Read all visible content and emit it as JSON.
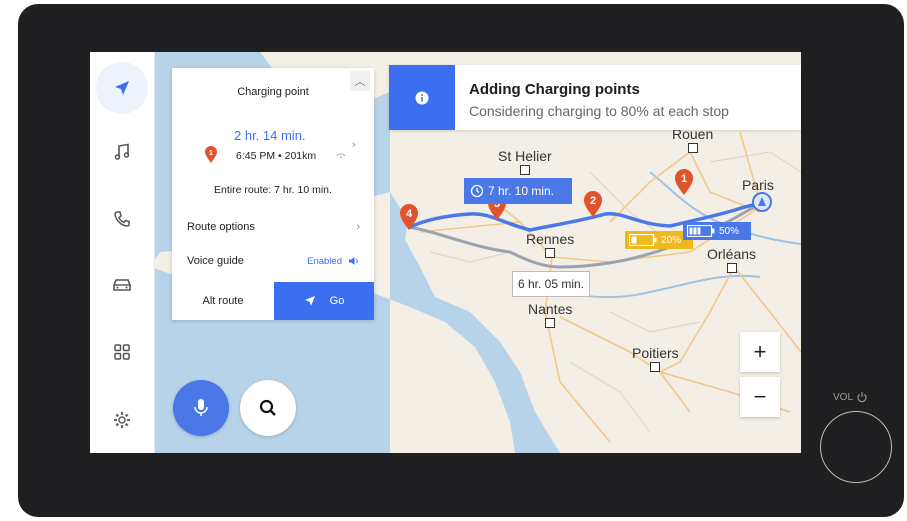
{
  "sidebar": {
    "items": [
      {
        "icon": "navigation-arrow-icon",
        "active": true
      },
      {
        "icon": "music-note-icon"
      },
      {
        "icon": "phone-icon"
      },
      {
        "icon": "car-icon"
      },
      {
        "icon": "apps-grid-icon"
      },
      {
        "icon": "gear-icon"
      }
    ]
  },
  "panel": {
    "title": "Charging point",
    "duration": "2 hr. 14 min.",
    "eta": "6:45 PM • 201km",
    "pin_number": "1",
    "entire_route": "Entire route: 7 hr. 10 min.",
    "route_options": "Route options",
    "voice_guide": "Voice guide",
    "voice_status": "Enabled",
    "alt_route": "Alt route",
    "go": "Go"
  },
  "info": {
    "heading": "Adding Charging points",
    "subtext": "Considering charging to 80% at each stop"
  },
  "map": {
    "route_time": "7 hr. 10 min.",
    "alt_time": "6 hr. 05 min.",
    "battery_low": "20%",
    "battery_high": "50%",
    "cities": {
      "rouen": "Rouen",
      "st_helier": "St Helier",
      "paris": "Paris",
      "rennes": "Rennes",
      "orleans": "Orléans",
      "nantes": "Nantes",
      "poitiers": "Poitiers"
    },
    "stops": [
      "1",
      "2",
      "3",
      "4"
    ]
  },
  "controls": {
    "zoom_in": "+",
    "zoom_out": "−",
    "volume_label": "VOL"
  },
  "colors": {
    "accent": "#3c6ff0",
    "route": "#4a78e6",
    "marker": "#e2532d",
    "battery_low": "#f0b81a"
  }
}
